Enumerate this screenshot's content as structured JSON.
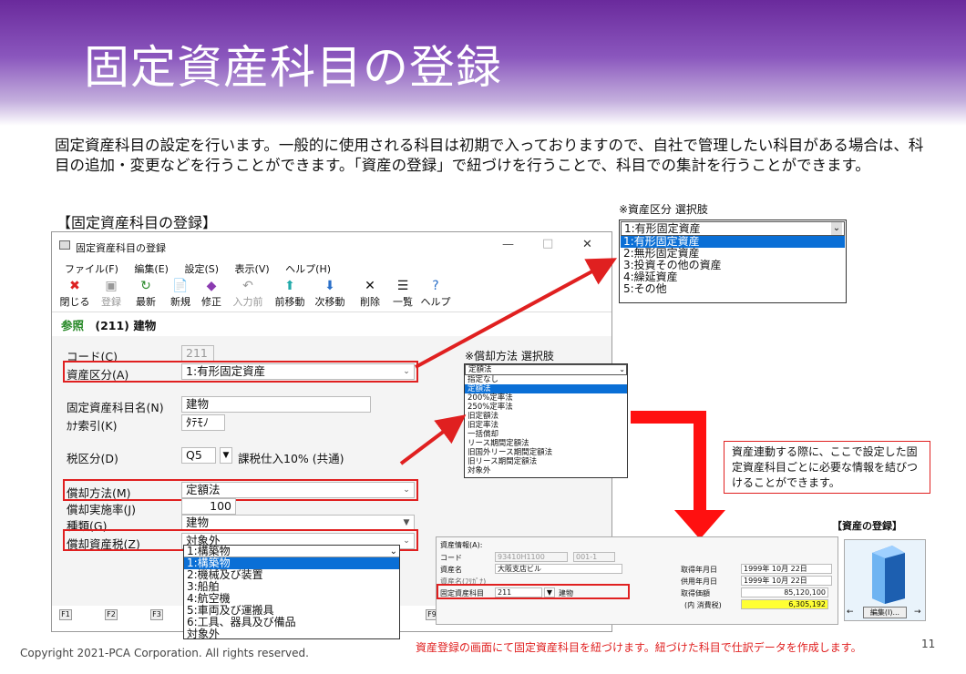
{
  "slide": {
    "title": "固定資産科目の登録",
    "intro": "固定資産科目の設定を行います。一般的に使用される科目は初期で入っておりますので、自社で管理したい科目がある場合は、科目の追加・変更などを行うことができます。「資産の登録」で紐づけを行うことで、科目での集計を行うことができます。",
    "section_label": "【固定資産科目の登録】",
    "asset_section_label": "【資産の登録】",
    "note": "資産連動する際に、ここで設定した固定資産科目ごとに必要な情報を結びつけることができます。",
    "footer_note": "資産登録の画面にて固定資産科目を紐づけます。紐づけた科目で仕訳データを作成します。",
    "copyright": "Copyright 2021-PCA Corporation. All rights reserved.",
    "page": "11"
  },
  "window": {
    "title": "固定資産科目の登録",
    "min": "—",
    "max": "□",
    "close": "✕",
    "menu": [
      "ファイル(F)",
      "編集(E)",
      "設定(S)",
      "表示(V)",
      "ヘルプ(H)"
    ],
    "toolbar": [
      {
        "label": "閉じる",
        "icon": "close-icon",
        "glyph": "✖"
      },
      {
        "label": "登録",
        "icon": "save-icon",
        "glyph": "▣"
      },
      {
        "label": "最新",
        "icon": "refresh-icon",
        "glyph": "↻"
      },
      {
        "label": "新規",
        "icon": "new-icon",
        "glyph": "📄"
      },
      {
        "label": "修正",
        "icon": "edit-icon",
        "glyph": "◆"
      },
      {
        "label": "入力前",
        "icon": "undo-icon",
        "glyph": "↶"
      },
      {
        "label": "前移動",
        "icon": "up-arrow-icon",
        "glyph": "⬆"
      },
      {
        "label": "次移動",
        "icon": "down-arrow-icon",
        "glyph": "⬇"
      },
      {
        "label": "削除",
        "icon": "delete-icon",
        "glyph": "✕"
      },
      {
        "label": "一覧",
        "icon": "list-icon",
        "glyph": "☰"
      },
      {
        "label": "ヘルプ",
        "icon": "help-icon",
        "glyph": "?"
      }
    ],
    "mode": "参照",
    "record": "(211) 建物",
    "fields": {
      "code_label": "コード(C)",
      "code_value": "211",
      "class_label": "資産区分(A)",
      "class_value": "1:有形固定資産",
      "name_label": "固定資産科目名(N)",
      "name_value": "建物",
      "kana_label": "ｶﾅ索引(K)",
      "kana_value": "ﾀﾃﾓﾉ",
      "tax_label": "税区分(D)",
      "tax_code": "Q5",
      "tax_value": "課税仕入10% (共通)",
      "method_label": "償却方法(M)",
      "method_value": "定額法",
      "rate_label": "償却実施率(J)",
      "rate_value": "100",
      "type_label": "種類(G)",
      "type_value": "建物",
      "dtax_label": "償却資産税(Z)",
      "dtax_value": "対象外"
    },
    "fkeys": [
      "F1",
      "F2",
      "F3",
      "F9"
    ]
  },
  "class_options": {
    "caption": "※資産区分 選択肢",
    "selected": "1:有形固定資産",
    "items": [
      "1:有形固定資産",
      "2:無形固定資産",
      "3:投資その他の資産",
      "4:繰延資産",
      "5:その他"
    ]
  },
  "method_options": {
    "caption": "※償却方法 選択肢",
    "selected": "定額法",
    "items": [
      "指定なし",
      "定額法",
      "200%定率法",
      "250%定率法",
      "旧定額法",
      "旧定率法",
      "一括償却",
      "リース期間定額法",
      "旧国外リース期間定額法",
      "旧リース期間定額法",
      "対象外"
    ]
  },
  "dtax_options": {
    "selected": "1:構築物",
    "items": [
      "1:構築物",
      "2:機械及び装置",
      "3:船舶",
      "4:航空機",
      "5:車両及び運搬具",
      "6:工具、器具及び備品",
      "対象外"
    ]
  },
  "asset": {
    "header": "資産情報(A):",
    "code_label": "コード",
    "code_value": "93410H1100",
    "code2": "001-1",
    "name_label": "資産名",
    "name_value": "大阪支店ビル",
    "kana_label": "資産名(ﾌﾘｶﾞﾅ)",
    "account_label": "固定資産科目",
    "account_code": "211",
    "account_name": "建物",
    "acq_date_label": "取得年月日",
    "acq_date": "1999年 10月 22日",
    "use_date_label": "供用年月日",
    "use_date": "1999年 10月 22日",
    "price_label": "取得価額",
    "price": "85,120,100",
    "tax_label": "(内 消費税)",
    "tax": "6,305,192",
    "edit_button": "編集(I)..."
  },
  "colors": {
    "accent_red": "#e02020",
    "select_blue": "#0a6fd6",
    "banner": "#7a3fb0"
  }
}
